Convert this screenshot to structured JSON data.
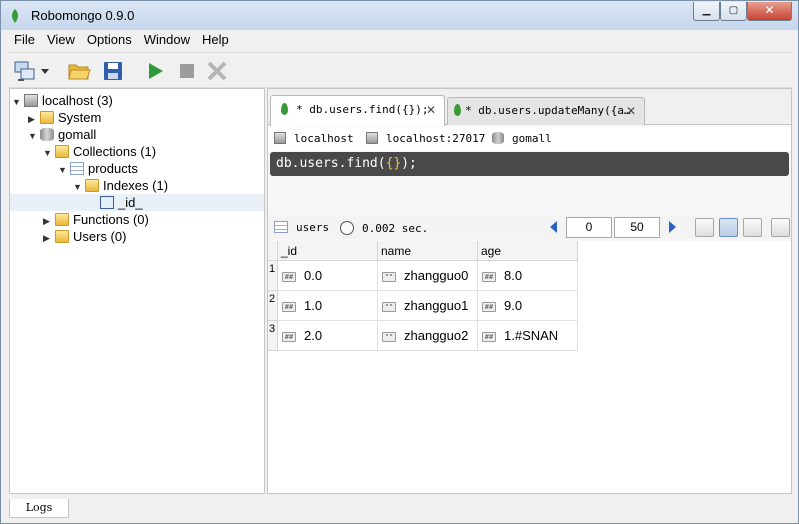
{
  "window": {
    "title": "Robomongo 0.9.0"
  },
  "menu": [
    "File",
    "View",
    "Options",
    "Window",
    "Help"
  ],
  "toolbar": {
    "icons": [
      "connect-icon",
      "dropdown-arrow-icon",
      "open-folder-icon",
      "save-icon",
      "run-icon",
      "stop-icon",
      "rotate-icon"
    ]
  },
  "tree": {
    "items": [
      {
        "label": "localhost (3)",
        "icon": "server-icon",
        "arrow": "▼"
      },
      {
        "label": "System",
        "icon": "folder-icon",
        "arrow": "▶"
      },
      {
        "label": "gomall",
        "icon": "database-icon",
        "arrow": "▼"
      },
      {
        "label": "Collections (1)",
        "icon": "folder-icon",
        "arrow": "▼"
      },
      {
        "label": "products",
        "icon": "table-icon",
        "arrow": "▼"
      },
      {
        "label": "Indexes (1)",
        "icon": "folder-icon",
        "arrow": "▼"
      },
      {
        "label": "_id_",
        "icon": "index-icon",
        "arrow": ""
      },
      {
        "label": "Functions (0)",
        "icon": "folder-icon",
        "arrow": "▶"
      },
      {
        "label": "Users (0)",
        "icon": "folder-icon",
        "arrow": "▶"
      }
    ]
  },
  "tabs": [
    {
      "label": "* db.users.find({});",
      "close": "✕"
    },
    {
      "label": "* db.users.updateMany({a…",
      "close": "✕"
    }
  ],
  "connection": {
    "server": "localhost",
    "address": "localhost:27017",
    "database": "gomall"
  },
  "query": {
    "prefix": "db.users.find(",
    "args": "{}",
    "suffix": ");"
  },
  "result": {
    "collection": "users",
    "time": "0.002 sec.",
    "skip": "0",
    "limit": "50"
  },
  "grid": {
    "columns": [
      "_id",
      "name",
      "age"
    ],
    "rows": [
      {
        "num": "1",
        "id": "0.0",
        "name": "zhangguo0",
        "age": "8.0"
      },
      {
        "num": "2",
        "id": "1.0",
        "name": "zhangguo1",
        "age": "9.0"
      },
      {
        "num": "3",
        "id": "2.0",
        "name": "zhangguo2",
        "age": "1.#SNAN"
      }
    ],
    "num_icon_text": "##",
    "str_icon_text": "\"\""
  },
  "bottom": {
    "logs_label": "Logs"
  },
  "colors": {
    "accent": "#3a9b35",
    "query_bg": "#494949",
    "query_brace": "#e8c24a"
  }
}
